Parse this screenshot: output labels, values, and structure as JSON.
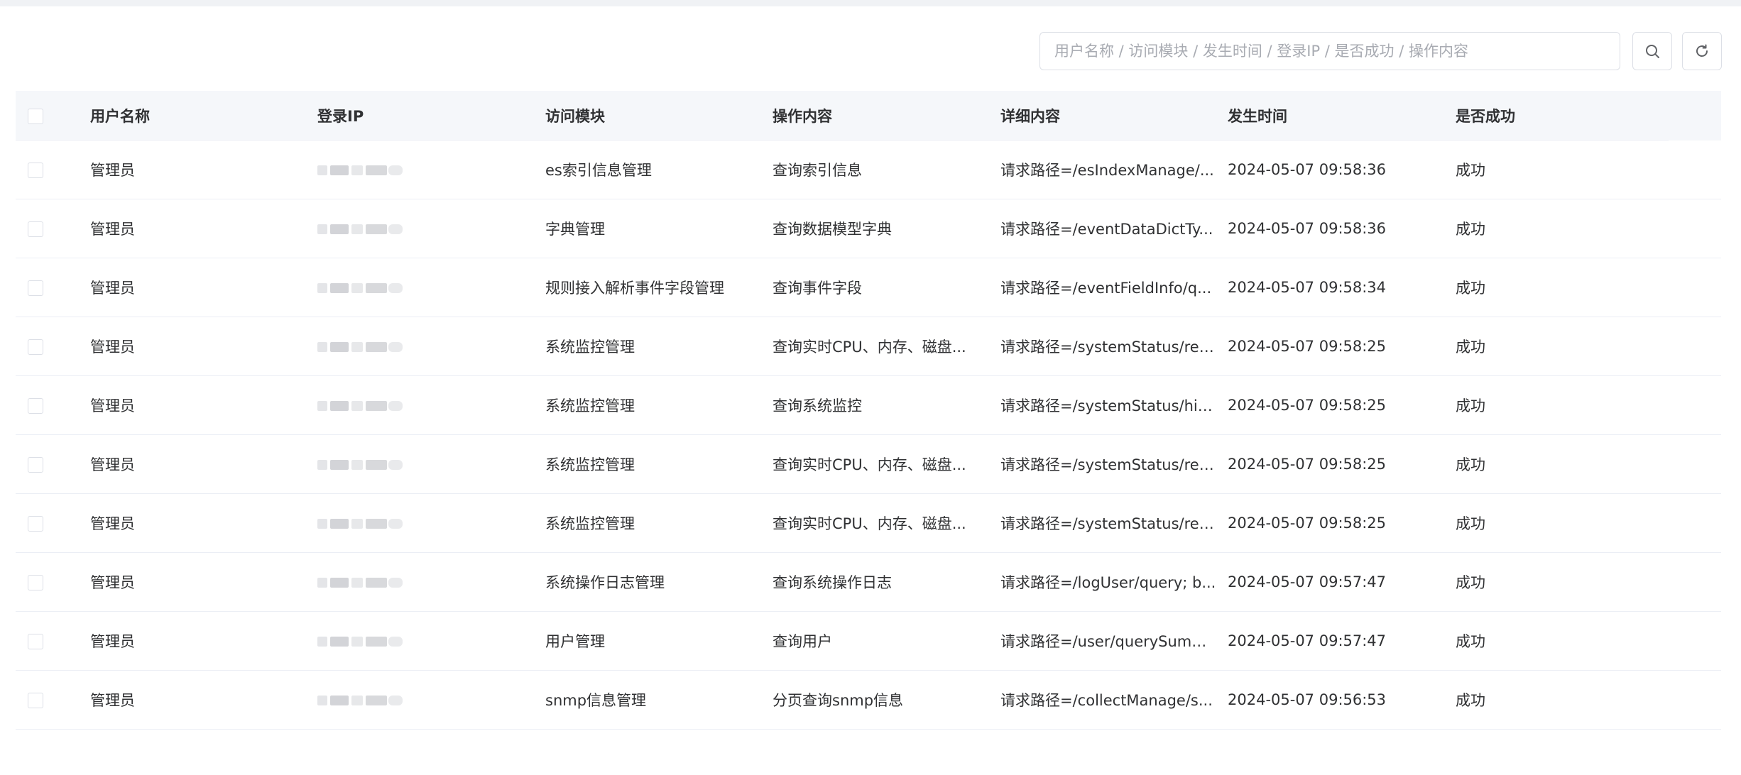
{
  "search": {
    "placeholder": "用户名称 / 访问模块 / 发生时间 / 登录IP / 是否成功 / 操作内容",
    "value": ""
  },
  "icons": {
    "search": "search-icon",
    "refresh": "refresh-icon"
  },
  "table": {
    "columns": [
      "用户名称",
      "登录IP",
      "访问模块",
      "操作内容",
      "详细内容",
      "发生时间",
      "是否成功"
    ],
    "rows": [
      {
        "user": "管理员",
        "module": "es索引信息管理",
        "operation": "查询索引信息",
        "detail": "请求路径=/esIndexManage/...",
        "time": "2024-05-07 09:58:36",
        "success": "成功"
      },
      {
        "user": "管理员",
        "module": "字典管理",
        "operation": "查询数据模型字典",
        "detail": "请求路径=/eventDataDictTy...",
        "time": "2024-05-07 09:58:36",
        "success": "成功"
      },
      {
        "user": "管理员",
        "module": "规则接入解析事件字段管理",
        "operation": "查询事件字段",
        "detail": "请求路径=/eventFieldInfo/q...",
        "time": "2024-05-07 09:58:34",
        "success": "成功"
      },
      {
        "user": "管理员",
        "module": "系统监控管理",
        "operation": "查询实时CPU、内存、磁盘...",
        "detail": "请求路径=/systemStatus/rea...",
        "time": "2024-05-07 09:58:25",
        "success": "成功"
      },
      {
        "user": "管理员",
        "module": "系统监控管理",
        "operation": "查询系统监控",
        "detail": "请求路径=/systemStatus/his...",
        "time": "2024-05-07 09:58:25",
        "success": "成功"
      },
      {
        "user": "管理员",
        "module": "系统监控管理",
        "operation": "查询实时CPU、内存、磁盘...",
        "detail": "请求路径=/systemStatus/rea...",
        "time": "2024-05-07 09:58:25",
        "success": "成功"
      },
      {
        "user": "管理员",
        "module": "系统监控管理",
        "operation": "查询实时CPU、内存、磁盘...",
        "detail": "请求路径=/systemStatus/rea...",
        "time": "2024-05-07 09:58:25",
        "success": "成功"
      },
      {
        "user": "管理员",
        "module": "系统操作日志管理",
        "operation": "查询系统操作日志",
        "detail": "请求路径=/logUser/query; b...",
        "time": "2024-05-07 09:57:47",
        "success": "成功"
      },
      {
        "user": "管理员",
        "module": "用户管理",
        "operation": "查询用户",
        "detail": "请求路径=/user/querySumm...",
        "time": "2024-05-07 09:57:47",
        "success": "成功"
      },
      {
        "user": "管理员",
        "module": "snmp信息管理",
        "operation": "分页查询snmp信息",
        "detail": "请求路径=/collectManage/s...",
        "time": "2024-05-07 09:56:53",
        "success": "成功"
      }
    ]
  }
}
